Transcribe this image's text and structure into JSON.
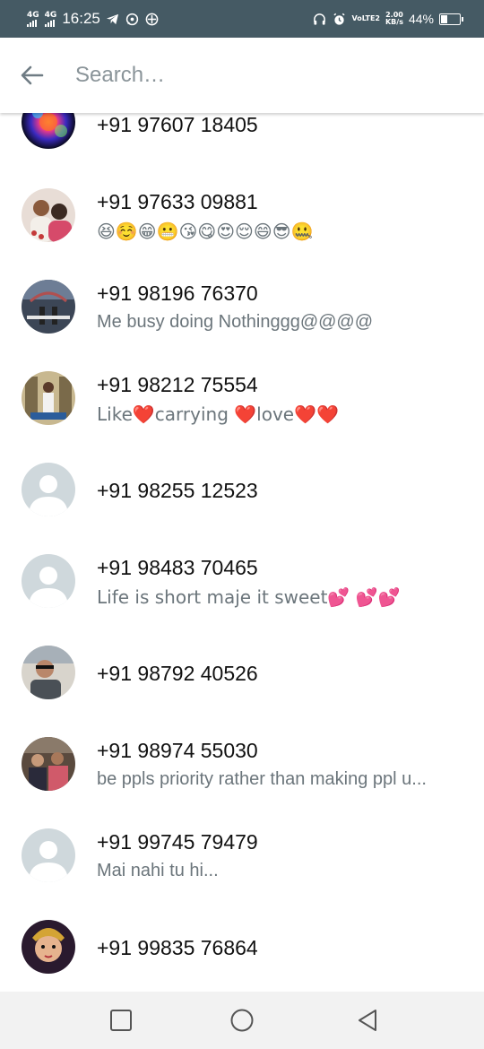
{
  "status_bar": {
    "network1": "4G",
    "network2": "4G",
    "time": "16:25",
    "volte": "VoLTE2",
    "speed_value": "2.00",
    "speed_unit": "KB/s",
    "battery": "44%",
    "battery_level": 0.44
  },
  "search": {
    "placeholder": "Search…"
  },
  "contacts": [
    {
      "number": "+91 97607 18405",
      "about": ""
    },
    {
      "number": "+91 97633 09881",
      "about": "😆☺️😁😬😘😋😍😌😄😎🤐"
    },
    {
      "number": "+91 98196 76370",
      "about": "Me busy doing Nothinggg@@@@"
    },
    {
      "number": "+91 98212 75554",
      "about": "Like❤️carrying ❤️love❤️❤️"
    },
    {
      "number": "+91 98255 12523",
      "about": ""
    },
    {
      "number": "+91 98483 70465",
      "about": "Life is short maje it sweet💕 💕💕"
    },
    {
      "number": "+91 98792 40526",
      "about": ""
    },
    {
      "number": "+91 98974 55030",
      "about": "be ppls priority rather than making ppl u..."
    },
    {
      "number": "+91 99745 79479",
      "about": "Mai nahi tu hi..."
    },
    {
      "number": "+91 99835 76864",
      "about": ""
    }
  ],
  "colors": {
    "status_bar": "#455a64",
    "default_avatar_bg": "#cfd8dc",
    "secondary_text": "#6b757b"
  }
}
